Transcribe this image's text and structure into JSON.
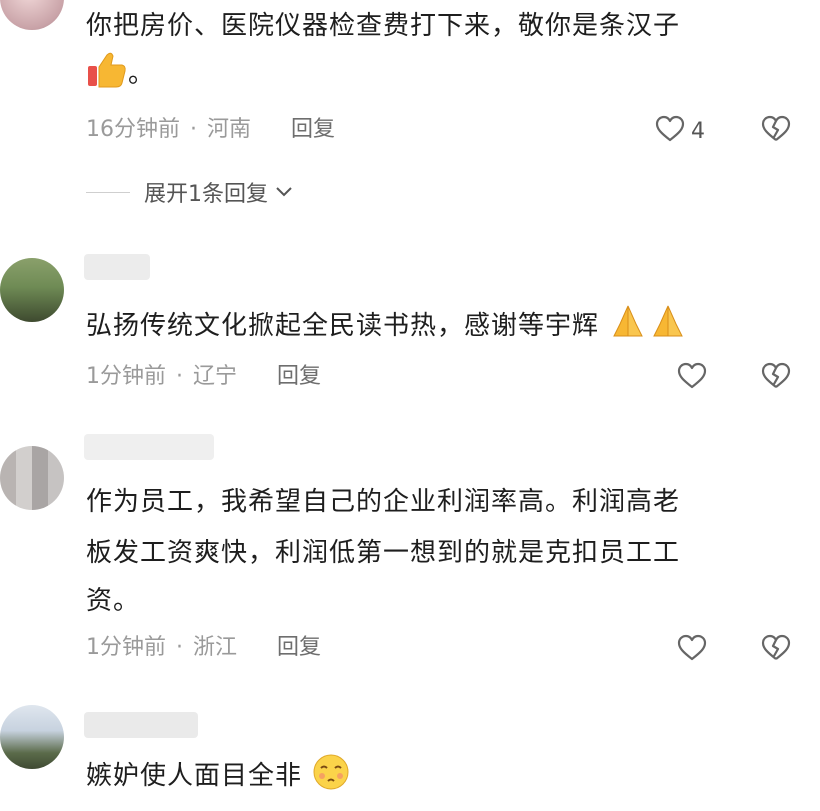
{
  "comments": [
    {
      "lines": [
        "你把房价、医院仪器检查费打下来，敬你是条汉子",
        "。"
      ],
      "time": "16分钟前",
      "location": "河南",
      "reply_label": "回复",
      "likes": "4",
      "expand_label": "展开1条回复"
    },
    {
      "lines": [
        "弘扬传统文化掀起全民读书热，感谢等宇辉"
      ],
      "time": "1分钟前",
      "location": "辽宁",
      "reply_label": "回复"
    },
    {
      "lines": [
        "作为员工，我希望自己的企业利润率高。利润高老",
        "板发工资爽快，利润低第一想到的就是克扣员工工",
        "资。"
      ],
      "time": "1分钟前",
      "location": "浙江",
      "reply_label": "回复"
    },
    {
      "lines": [
        "嫉妒使人面目全非"
      ]
    }
  ],
  "icons": {
    "like": "heart-outline",
    "dislike": "broken-heart-outline",
    "thumbs_up": "thumbs-up-emoji",
    "pray": "folded-hands-emoji",
    "blush": "flushed-emoji"
  }
}
